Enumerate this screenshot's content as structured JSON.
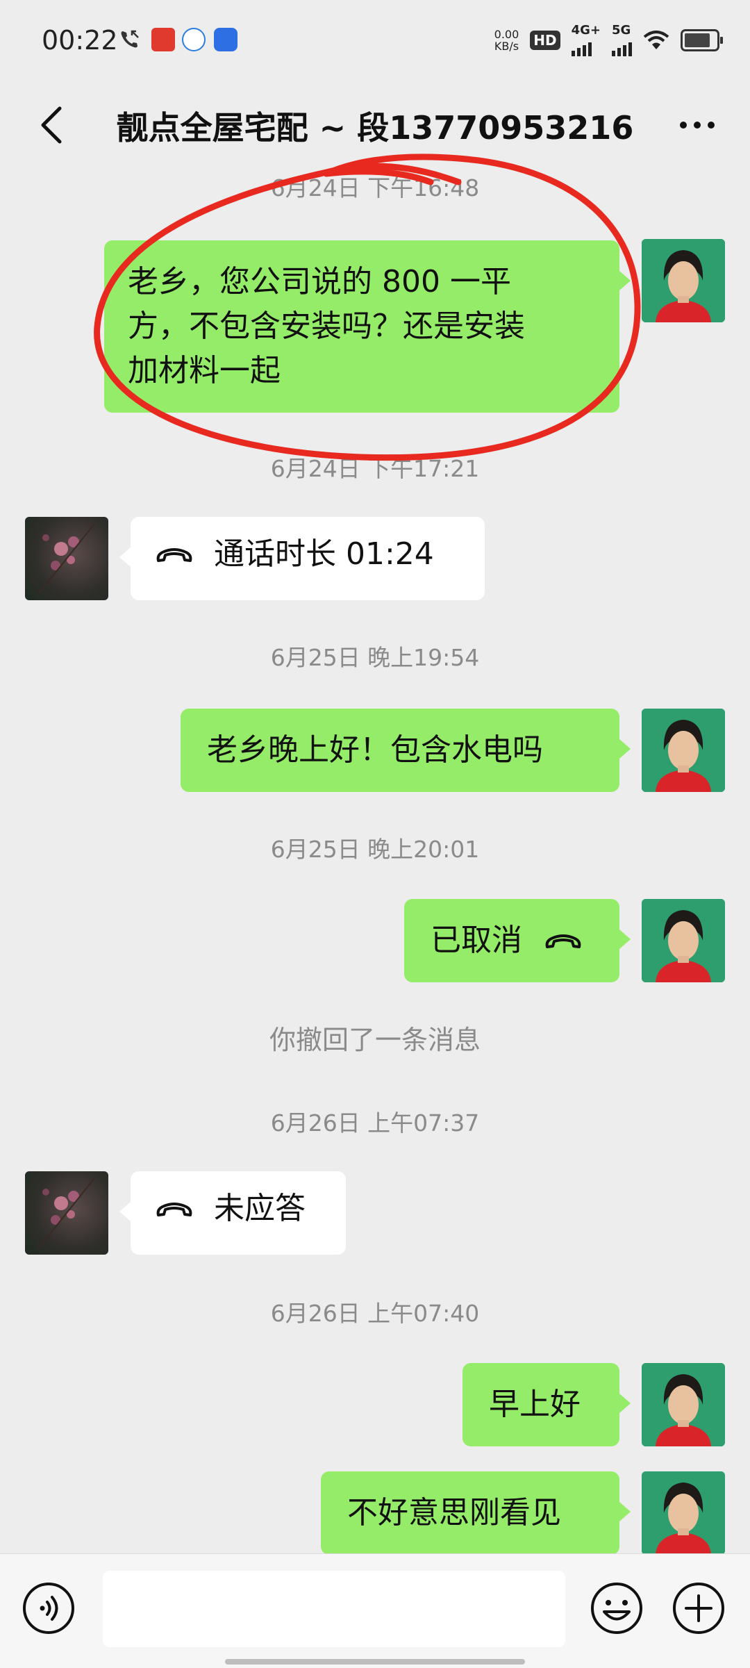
{
  "status_bar": {
    "time": "00:22",
    "net_speed_value": "0.00",
    "net_speed_unit": "KB/s",
    "hd_label": "HD",
    "network_1": "4G+",
    "network_2": "5G"
  },
  "header": {
    "back_icon": "chevron-left-icon",
    "title": "靓点全屋宅配 ~ 段13770953216",
    "more_icon": "more-horizontal-icon"
  },
  "messages": [
    {
      "type": "time",
      "text": "6月24日 下午16:48"
    },
    {
      "type": "text",
      "from": "me",
      "text_line1": "老乡，您公司说的 800 一平",
      "text_line2": "方，不包含安装吗？还是安装",
      "text_line3": "加材料一起"
    },
    {
      "type": "time",
      "text": "6月24日 下午17:21"
    },
    {
      "type": "call",
      "from": "peer",
      "text": "通话时长 01:24"
    },
    {
      "type": "time",
      "text": "6月25日 晚上19:54"
    },
    {
      "type": "text",
      "from": "me",
      "text": "老乡晚上好！包含水电吗"
    },
    {
      "type": "time",
      "text": "6月25日 晚上20:01"
    },
    {
      "type": "call",
      "from": "me",
      "text": "已取消"
    },
    {
      "type": "system",
      "text": "你撤回了一条消息"
    },
    {
      "type": "time",
      "text": "6月26日 上午07:37"
    },
    {
      "type": "call",
      "from": "peer",
      "text": "未应答"
    },
    {
      "type": "time",
      "text": "6月26日 上午07:40"
    },
    {
      "type": "text",
      "from": "me",
      "text": "早上好"
    },
    {
      "type": "text",
      "from": "me",
      "text": "不好意思刚看见"
    }
  ],
  "input_bar": {
    "voice_icon": "voice-icon",
    "placeholder": "",
    "emoji_icon": "emoji-icon",
    "plus_icon": "plus-icon"
  },
  "colors": {
    "background": "#ededed",
    "my_bubble": "#95ec69",
    "peer_bubble": "#ffffff",
    "annotation_circle": "#e8291f"
  }
}
